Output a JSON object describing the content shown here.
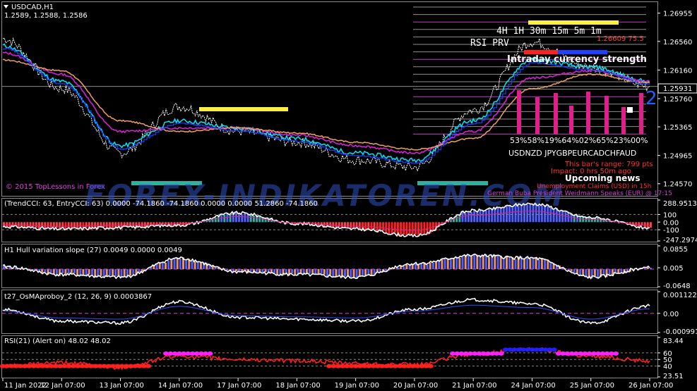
{
  "symbol": "USDCAD,H1",
  "ohlc_readout": "1.2589, 1.2588, 1.2586",
  "copyright": "© 2015 TopLessons in Forex",
  "watermark": "FOREX-INDIKATOREN.COM",
  "timeframes_label": "4H 1H 30m 15m 5m 1m",
  "rsi_prv_label": "RSI PRV",
  "strength_title": "Intraday currency strength",
  "strength_big_number": "2",
  "strength_percents": "53%58%19%64%02%65%23%00%",
  "currency_pairs": "USDNZD JPYGBPEURCADCHFAUD",
  "top_right_red": "1.26609 75.5",
  "upcoming_news_title": "Upcoming news",
  "news_lines": [
    "This bar's range: 799 pts",
    "Impact: 0 hrs 50m ago",
    "Unemployment Claims (USD) in 15h",
    "German Buba President Weidmann Speaks (EUR) @ 17:15"
  ],
  "price_labels": [
    "1.26955",
    "1.26560",
    "1.26160",
    "1.25760",
    "1.25365",
    "1.24965",
    "1.24570"
  ],
  "current_price": "1.25931",
  "cci_header": "(TrendCCI: 63, EntryCCI: 63)  0.0000 -74.1860 -74.1860 0.0000 0.0000 51.2860 -74.1860",
  "cci_labels": [
    "288.9513",
    "100",
    "0.00",
    "-100",
    "-247.2974"
  ],
  "hull_header": "H1 Hull variation slope (27) 0.0049 0.0000 0.0049",
  "hull_labels": [
    "0.0855",
    "0.005",
    "-0.0648"
  ],
  "osma_header": "t27_OsMAproboy_2 (12, 26, 9) 0.0003867",
  "osma_labels": [
    "0.0011225",
    "0.00",
    "-0.0009911"
  ],
  "rsi_header": "RSI(21) (Alert on) 48.02 48.02",
  "rsi_labels": [
    "83.44",
    "60",
    "50",
    "40",
    "23.51"
  ],
  "time_labels": [
    "11 Jan 2022",
    "12 Jan 07:00",
    "13 Jan 07:00",
    "14 Jan 07:00",
    "17 Jan 07:00",
    "18 Jan 07:00",
    "19 Jan 07:00",
    "20 Jan 07:00",
    "21 Jan 07:00",
    "24 Jan 07:00",
    "25 Jan 07:00",
    "26 Jan 07:00"
  ],
  "colors": {
    "background": "#000000",
    "price_line": "#ffffff",
    "cyan": "#00e5ff",
    "magenta": "#e020e0",
    "orange": "#f0a060",
    "blue": "#2040ff",
    "red": "#ff2020",
    "yellow": "#ffee44",
    "teal": "#30b0a0",
    "salmon": "#e89070"
  },
  "chart_data": {
    "type": "line",
    "x": [
      "11 Jan 2022",
      "12 Jan 07:00",
      "13 Jan 07:00",
      "14 Jan 07:00",
      "17 Jan 07:00",
      "18 Jan 07:00",
      "19 Jan 07:00",
      "20 Jan 07:00",
      "21 Jan 07:00",
      "24 Jan 07:00",
      "25 Jan 07:00",
      "26 Jan 07:00"
    ],
    "series": [
      {
        "values": [
          1.266,
          1.259,
          1.25,
          1.2565,
          1.253,
          1.2515,
          1.249,
          1.248,
          1.256,
          1.2655,
          1.262,
          1.2593
        ]
      },
      {
        "values": [
          1.265,
          1.26,
          1.251,
          1.2545,
          1.2535,
          1.252,
          1.25,
          1.249,
          1.2545,
          1.263,
          1.262,
          1.26
        ]
      },
      {
        "values": [
          1.264,
          1.261,
          1.253,
          1.2535,
          1.2535,
          1.2525,
          1.251,
          1.25,
          1.253,
          1.2605,
          1.2615,
          1.26
        ]
      },
      {
        "values": [
          1.263,
          1.2615,
          1.2545,
          1.253,
          1.2535,
          1.2528,
          1.2515,
          1.2505,
          1.252,
          1.259,
          1.261,
          1.2598
        ]
      }
    ],
    "ylim": [
      1.244,
      1.271
    ],
    "price_ticks": [
      1.26955,
      1.2656,
      1.2616,
      1.2576,
      1.25365,
      1.24965,
      1.2457
    ],
    "current_price": 1.25931,
    "cci": {
      "values": [
        -60,
        -90,
        -70,
        -40,
        120,
        -20,
        -90,
        -180,
        150,
        240,
        60,
        -74.186
      ],
      "ylim": [
        -247.2974,
        288.9513
      ]
    },
    "hull": {
      "values": [
        0.01,
        -0.02,
        -0.03,
        0.04,
        -0.01,
        -0.02,
        -0.03,
        0.02,
        0.05,
        0.04,
        -0.03,
        0.0049
      ],
      "ylim": [
        -0.0648,
        0.0855
      ]
    },
    "osma": {
      "values": [
        0.0002,
        -0.0004,
        -0.0005,
        0.0006,
        -0.0002,
        -0.0003,
        -0.0004,
        0.0002,
        0.0007,
        0.0005,
        -0.0005,
        0.0003867
      ],
      "ylim": [
        -0.0009911,
        0.0011225
      ]
    },
    "rsi": {
      "values": [
        40,
        45,
        38,
        55,
        50,
        48,
        44,
        42,
        58,
        66,
        55,
        48.02
      ],
      "ylim": [
        23.51,
        83.44
      ],
      "levels": [
        60,
        50,
        40
      ]
    }
  }
}
